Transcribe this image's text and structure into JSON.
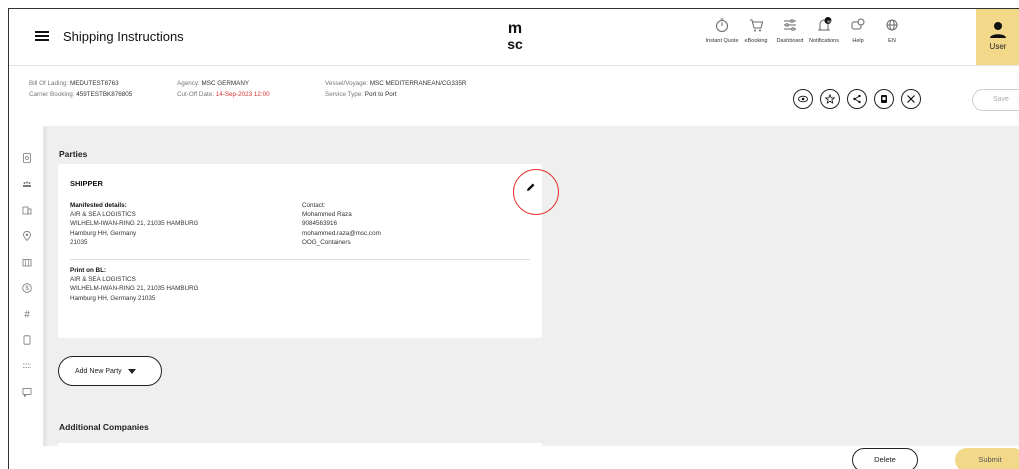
{
  "header": {
    "title": "Shipping Instructions",
    "logo_text": "msc",
    "nav": [
      {
        "label": "Instant Quote",
        "icon": "stopwatch-icon"
      },
      {
        "label": "eBooking",
        "icon": "cart-icon"
      },
      {
        "label": "Dashboard",
        "icon": "sliders-icon"
      },
      {
        "label": "Notifications",
        "icon": "bell-icon",
        "badge": "99+"
      },
      {
        "label": "Help",
        "icon": "help-chat-icon"
      },
      {
        "label": "EN",
        "icon": "globe-icon"
      }
    ],
    "user_label": "User"
  },
  "info": {
    "bol_label": "Bill Of Lading:",
    "bol_value": "MEDUTEST8763",
    "carrier_label": "Carrier Booking:",
    "carrier_value": "459TESTBK876805",
    "agency_label": "Agency:",
    "agency_value": "MSC GERMANY",
    "cutoff_label": "Cut-Off Date:",
    "cutoff_value": "14-Sep-2023 12:00",
    "vessel_label": "Vessel/Voyage:",
    "vessel_value": "MSC MEDITERRANEAN/CG335R",
    "service_label": "Service Type:",
    "service_value": "Port to Port",
    "save_label": "Save"
  },
  "parties": {
    "section_title": "Parties",
    "shipper": {
      "heading": "SHIPPER",
      "manifested_label": "Manifested details:",
      "manifested_lines": [
        "AIR & SEA LOGISTICS",
        "WILHELM-IWAN-RING 21, 21035 HAMBURG",
        "Hamburg HH, Germany",
        "21035"
      ],
      "contact_label": "Contact:",
      "contact_lines": [
        "Mohammed Raza",
        "9084563916",
        "mohammed.raza@msc.com",
        "OOG_Containers"
      ],
      "print_label": "Print on BL:",
      "print_lines": [
        "AIR & SEA LOGISTICS",
        "WILHELM-IWAN-RING 21, 21035 HAMBURG",
        "Hamburg HH, Germany 21035"
      ]
    },
    "add_party_label": "Add New Party"
  },
  "additional": {
    "section_title": "Additional Companies"
  },
  "footer": {
    "delete_label": "Delete",
    "submit_label": "Submit"
  },
  "colors": {
    "accent": "#f2d98a",
    "highlight": "#e53935",
    "cutoff": "#d32f2f"
  }
}
